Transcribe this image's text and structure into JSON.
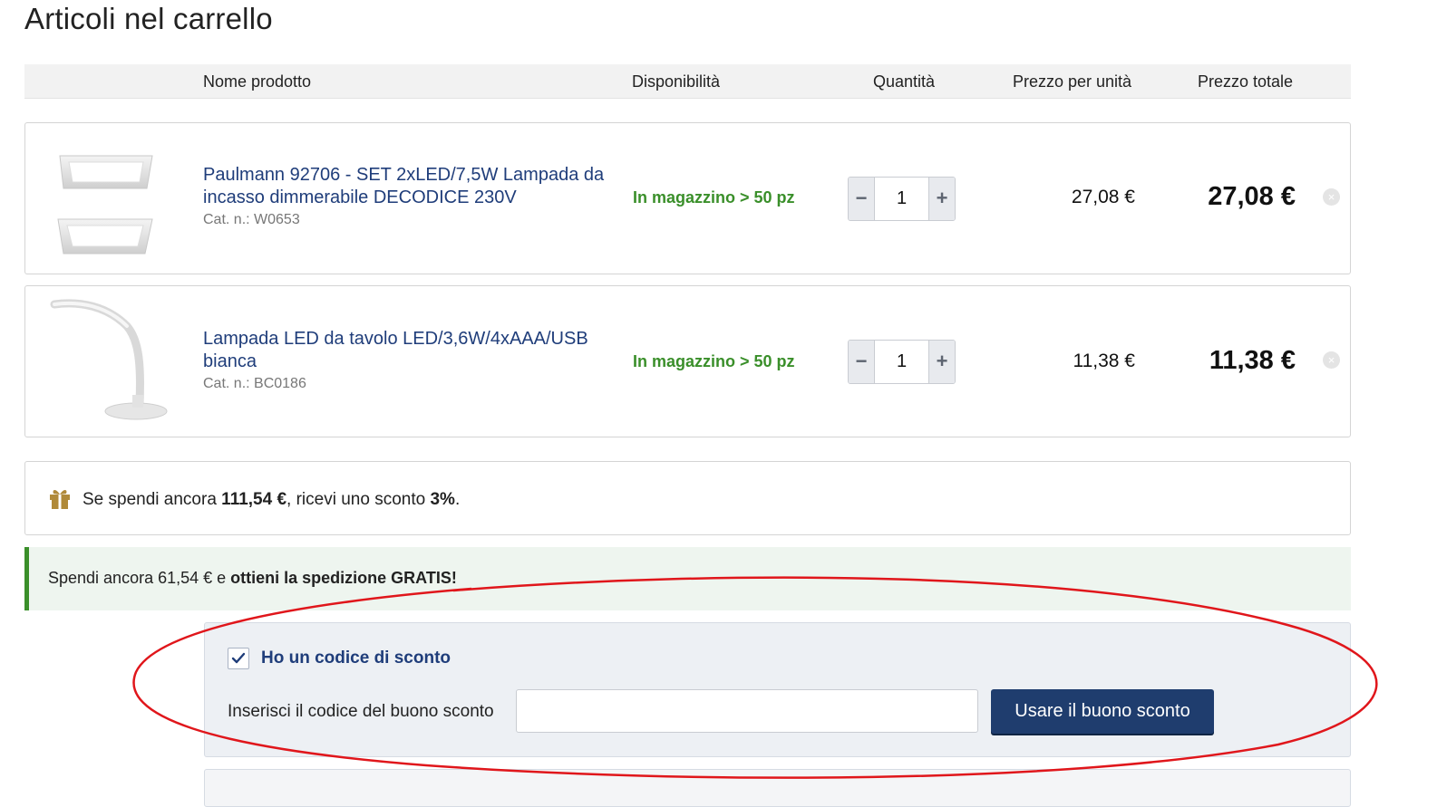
{
  "page": {
    "title": "Articoli nel carrello"
  },
  "table_header": {
    "product_name": "Nome prodotto",
    "availability": "Disponibilità",
    "quantity": "Quantità",
    "unit_price": "Prezzo per unità",
    "total_price": "Prezzo totale"
  },
  "items": [
    {
      "name": "Paulmann 92706 - SET 2xLED/7,5W Lampada da incasso dimmerabile DECODICE 230V",
      "catalog_no": "Cat. n.: W0653",
      "availability": "In magazzino > 50 pz",
      "quantity": "1",
      "unit_price": "27,08 €",
      "total_price": "27,08 €",
      "image_icon": "recessed-panel-lamp-image"
    },
    {
      "name": "Lampada LED da tavolo LED/3,6W/4xAAA/USB bianca",
      "catalog_no": "Cat. n.: BC0186",
      "availability": "In magazzino > 50 pz",
      "quantity": "1",
      "unit_price": "11,38 €",
      "total_price": "11,38 €",
      "image_icon": "desk-lamp-image"
    }
  ],
  "controls": {
    "minus": "−",
    "plus": "+",
    "remove": "×"
  },
  "promo": {
    "icon": "gift-icon",
    "text_before": "Se spendi ancora ",
    "amount": "111,54 €",
    "text_middle": ", ricevi uno sconto ",
    "percent": "3%",
    "text_end": "."
  },
  "shipping": {
    "text_before": "Spendi ancora 61,54 € e ",
    "text_bold": "ottieni la spedizione GRATIS!"
  },
  "coupon": {
    "checkbox_label": "Ho un codice di sconto",
    "checked": true,
    "field_label": "Inserisci il codice del buono sconto",
    "input_value": "",
    "button_label": "Usare il buono sconto"
  },
  "colors": {
    "link_blue": "#1f3d7a",
    "stock_green": "#3a8f2a",
    "button_navy": "#1f3d6e",
    "annotation_red": "#e0161b",
    "gift_gold": "#b08a3a"
  }
}
